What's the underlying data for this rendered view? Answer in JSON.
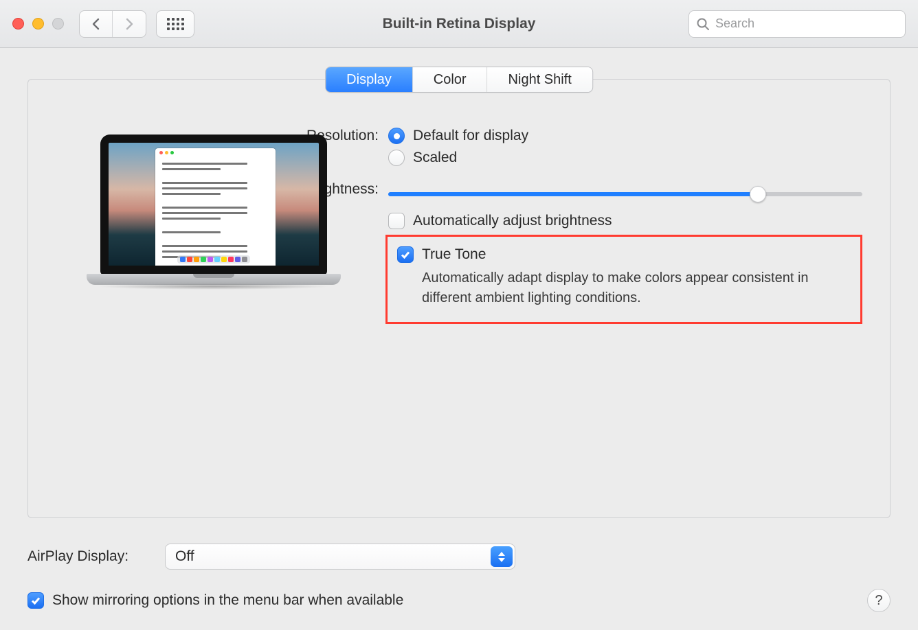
{
  "window": {
    "title": "Built-in Retina Display"
  },
  "search": {
    "placeholder": "Search"
  },
  "tabs": {
    "display": "Display",
    "color": "Color",
    "nightshift": "Night Shift"
  },
  "resolution": {
    "label": "Resolution:",
    "default": "Default for display",
    "scaled": "Scaled"
  },
  "brightness": {
    "label": "Brightness:",
    "value_percent": 78,
    "auto_label": "Automatically adjust brightness",
    "auto_checked": false
  },
  "truetone": {
    "label": "True Tone",
    "checked": true,
    "description": "Automatically adapt display to make colors appear consistent in different ambient lighting conditions."
  },
  "airplay": {
    "label": "AirPlay Display:",
    "value": "Off"
  },
  "mirroring": {
    "label": "Show mirroring options in the menu bar when available",
    "checked": true
  },
  "help": "?"
}
